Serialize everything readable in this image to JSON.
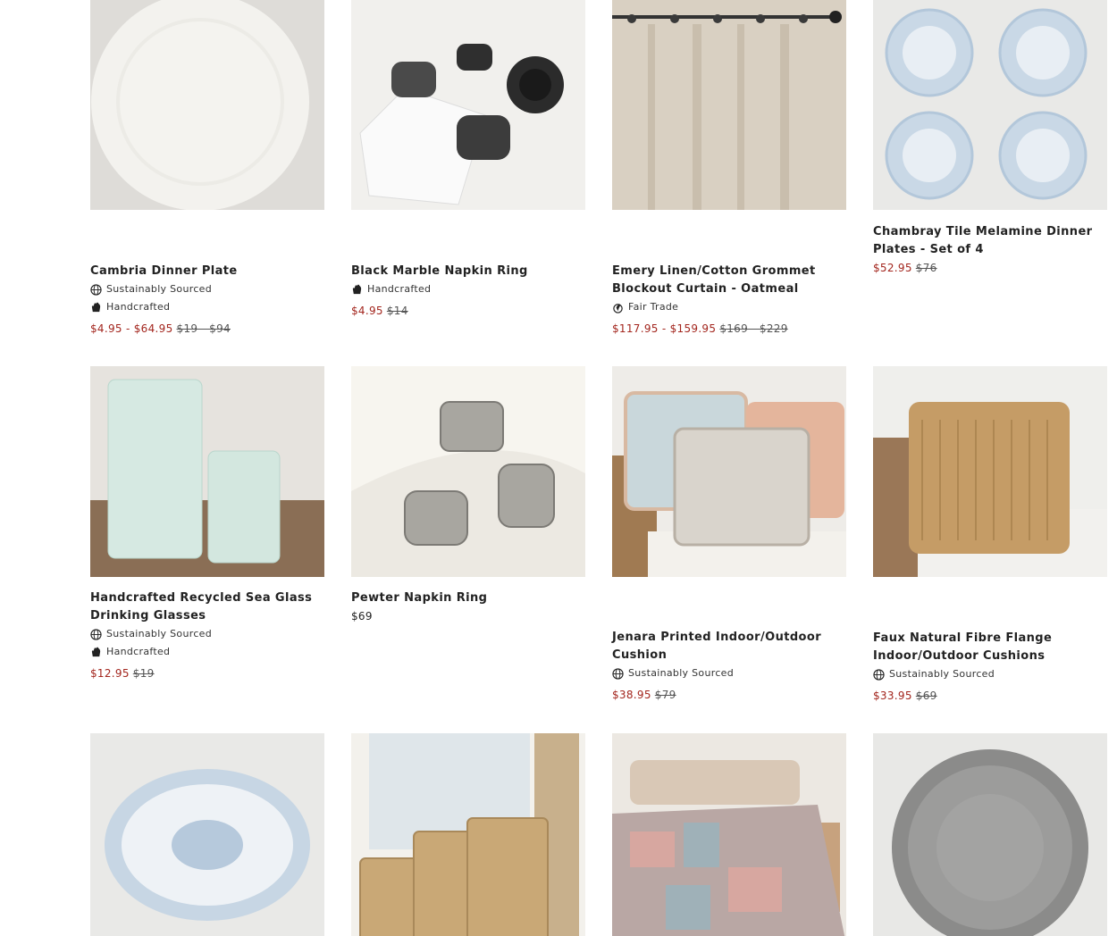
{
  "products": [
    {
      "title": "Cambria Dinner Plate",
      "badges": [
        "Sustainably Sourced",
        "Handcrafted"
      ],
      "sale_price": "$4.95 - $64.95",
      "orig_price": "$19 - $94"
    },
    {
      "title": "Black Marble Napkin Ring",
      "badges": [
        "Handcrafted"
      ],
      "sale_price": "$4.95",
      "orig_price": "$14"
    },
    {
      "title": "Emery Linen/Cotton Grommet Blockout Curtain - Oatmeal",
      "badges": [
        "Fair Trade"
      ],
      "sale_price": "$117.95 - $159.95",
      "orig_price": "$169 - $229"
    },
    {
      "title": "Chambray Tile Melamine Dinner Plates - Set of 4",
      "badges": [],
      "sale_price": "$52.95",
      "orig_price": "$76"
    },
    {
      "title": "Handcrafted Recycled Sea Glass Drinking Glasses",
      "badges": [
        "Sustainably Sourced",
        "Handcrafted"
      ],
      "sale_price": "$12.95",
      "orig_price": "$19"
    },
    {
      "title": "Pewter Napkin Ring",
      "badges": [],
      "price": "$69"
    },
    {
      "title": "Jenara Printed Indoor/Outdoor Cushion",
      "badges": [
        "Sustainably Sourced"
      ],
      "sale_price": "$38.95",
      "orig_price": "$79"
    },
    {
      "title": "Faux Natural Fibre Flange Indoor/Outdoor Cushions",
      "badges": [
        "Sustainably Sourced"
      ],
      "sale_price": "$33.95",
      "orig_price": "$69"
    }
  ],
  "colors": {
    "sale": "#a3261e",
    "text": "#222222",
    "image_bg": "#e8e6e2"
  },
  "icons": {
    "Sustainably Sourced": "globe-icon",
    "Handcrafted": "hand-icon",
    "Fair Trade": "fair-trade-icon"
  }
}
